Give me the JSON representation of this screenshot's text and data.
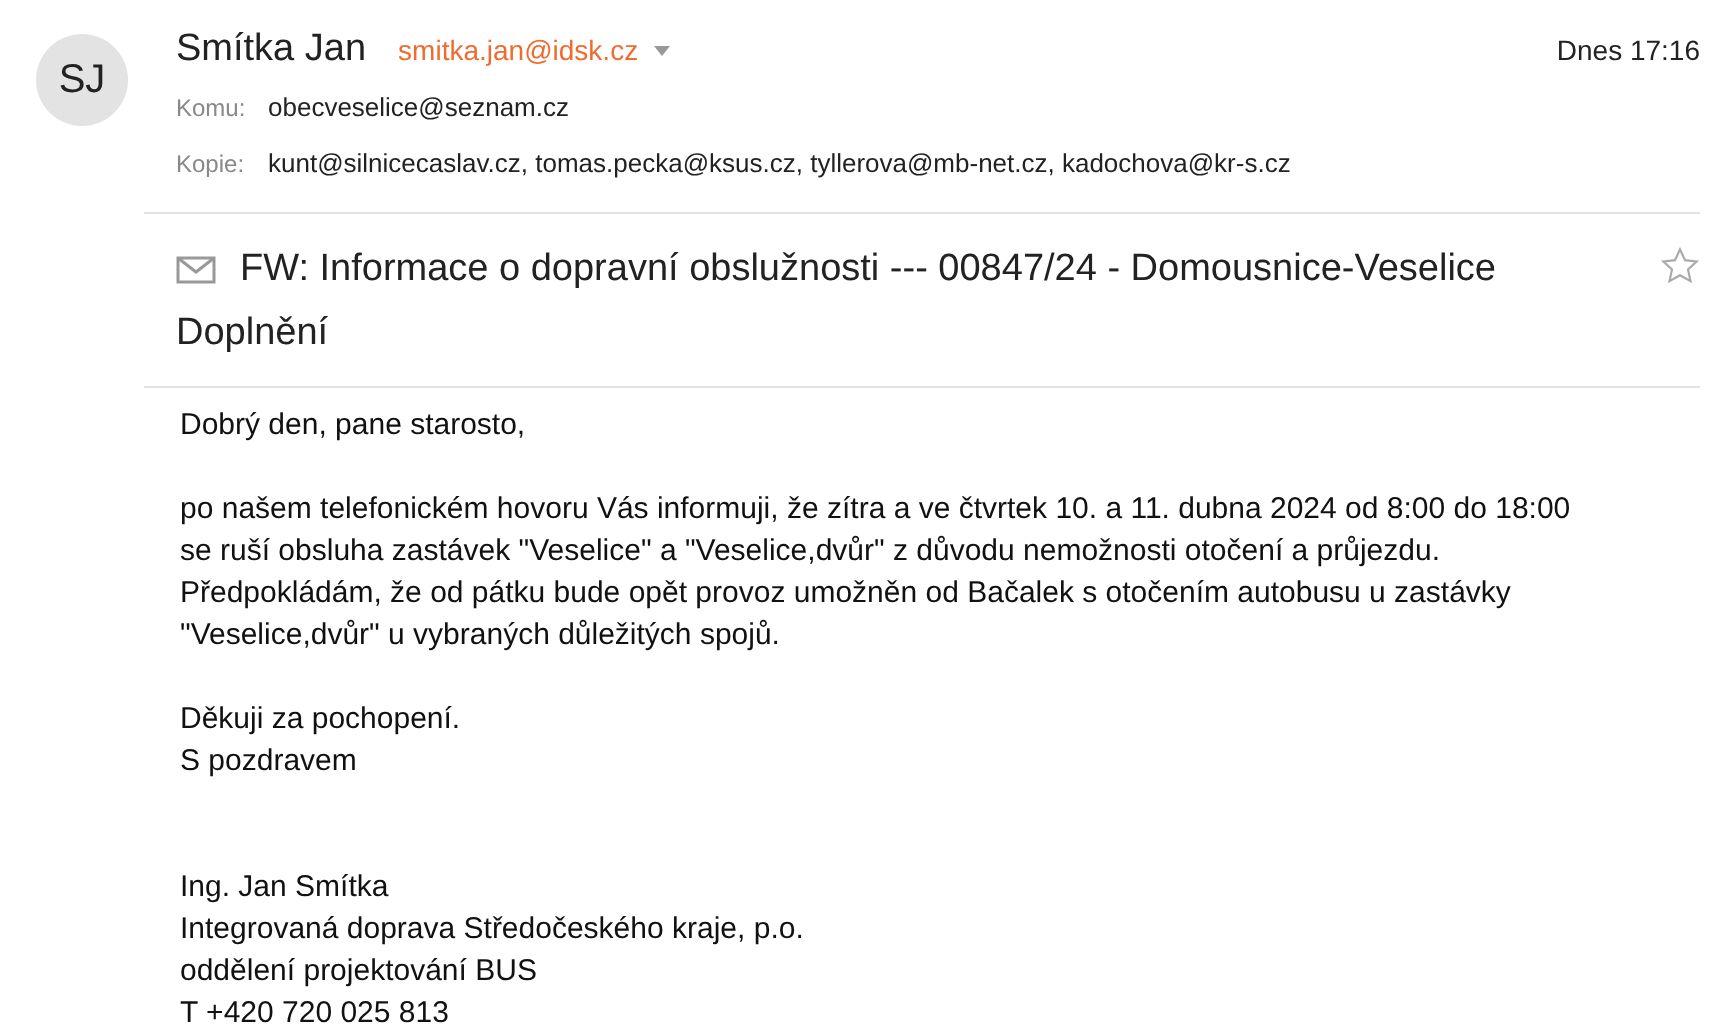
{
  "sender": {
    "initials": "SJ",
    "name": "Smítka Jan",
    "email": "smitka.jan@idsk.cz",
    "date": "Dnes 17:16"
  },
  "recipients": [
    {
      "label": "Komu:",
      "value": "obecveselice@seznam.cz"
    },
    {
      "label": "Kopie:",
      "value": "kunt@silnicecaslav.cz, tomas.pecka@ksus.cz, tyllerova@mb-net.cz, kadochova@kr-s.cz"
    }
  ],
  "subject": {
    "lines": [
      "FW: Informace o dopravní obslužnosti --- 00847/24 - Domousnice-Veselice",
      "Doplnění"
    ],
    "starred": false
  },
  "body": [
    [
      "Dobrý den, pane starosto,"
    ],
    [
      "po našem telefonickém hovoru Vás informuji, že zítra a ve čtvrtek 10. a 11. dubna 2024 od 8:00 do 18:00",
      "se ruší obsluha zastávek \"Veselice\" a \"Veselice,dvůr\" z důvodu nemožnosti otočení a průjezdu.",
      "Předpokládám, že od pátku bude opět provoz umožněn od Bačalek s otočením autobusu u zastávky",
      "\"Veselice,dvůr\" u vybraných důležitých spojů."
    ],
    [
      "Děkuji za pochopení.",
      "S pozdravem"
    ],
    [
      "Ing. Jan Smítka",
      "Integrovaná doprava Středočeského kraje, p.o.",
      "oddělení projektování BUS",
      "T +420 720 025 813"
    ]
  ]
}
